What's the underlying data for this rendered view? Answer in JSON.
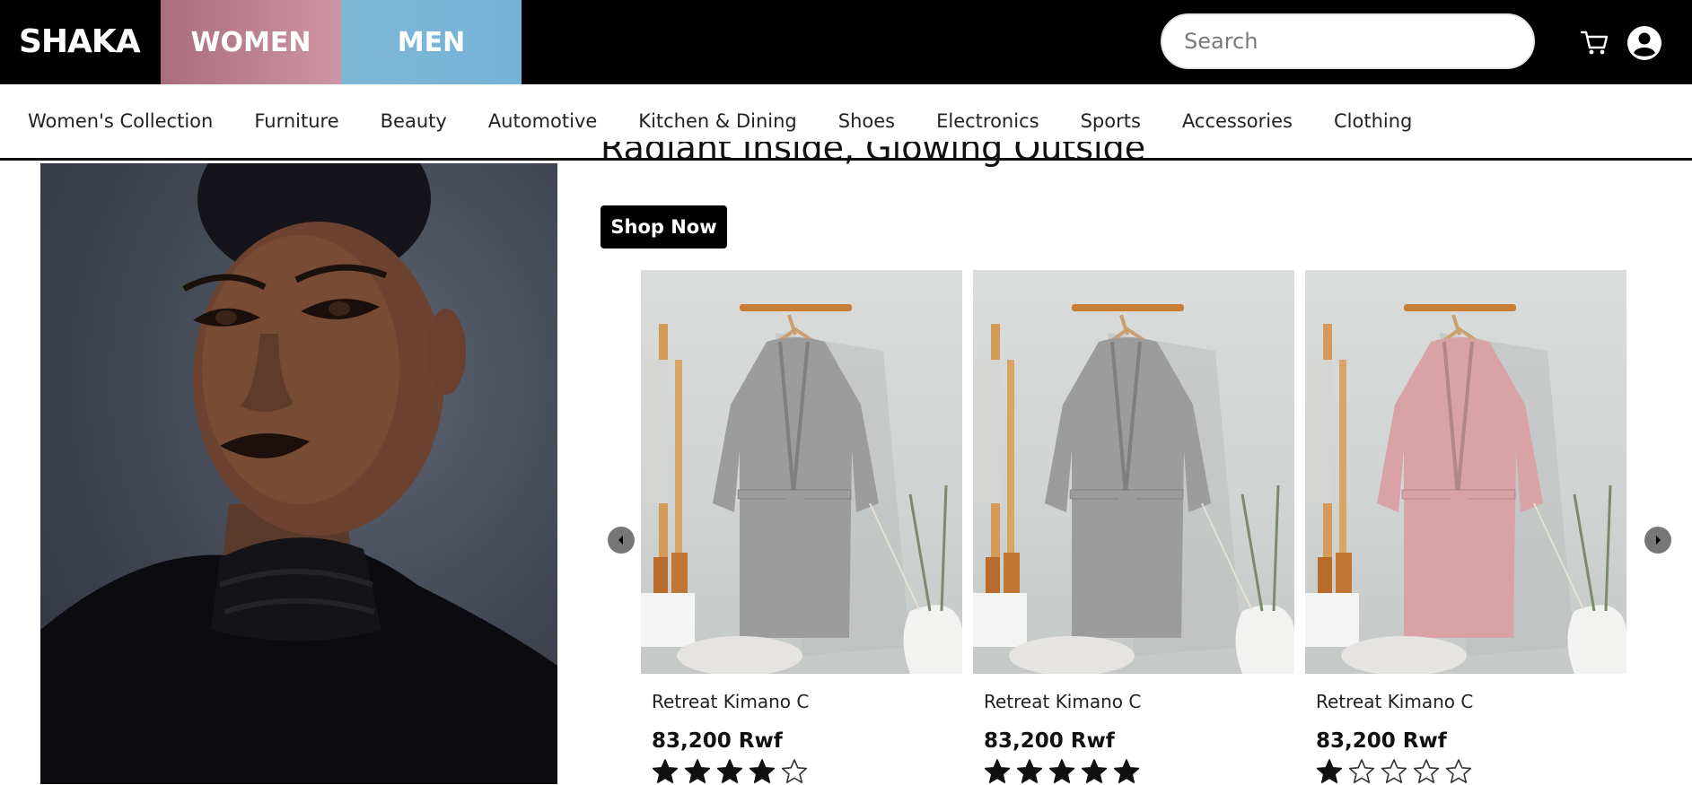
{
  "brand": {
    "logo": "SHAKA"
  },
  "gender_tabs": [
    {
      "label": "WOMEN"
    },
    {
      "label": "MEN"
    }
  ],
  "search": {
    "placeholder": "Search",
    "value": ""
  },
  "icons": {
    "cart": "cart-icon",
    "account": "account-icon"
  },
  "categories": [
    {
      "label": "Women's Collection"
    },
    {
      "label": "Furniture"
    },
    {
      "label": "Beauty"
    },
    {
      "label": "Automotive"
    },
    {
      "label": "Kitchen & Dining"
    },
    {
      "label": "Shoes"
    },
    {
      "label": "Electronics"
    },
    {
      "label": "Sports"
    },
    {
      "label": "Accessories"
    },
    {
      "label": "Clothing"
    }
  ],
  "hero": {
    "headline": "Radiant Inside, Glowing Outside",
    "cta_label": "Shop Now"
  },
  "carousel": {
    "products": [
      {
        "name": "Retreat Kimano C",
        "price": "83,200 Rwf",
        "rating": 4,
        "max_rating": 5,
        "robe_color": "#9c9c9c"
      },
      {
        "name": "Retreat Kimano C",
        "price": "83,200 Rwf",
        "rating": 5,
        "max_rating": 5,
        "robe_color": "#9c9c9c"
      },
      {
        "name": "Retreat Kimano C",
        "price": "83,200 Rwf",
        "rating": 1,
        "max_rating": 5,
        "robe_color": "#d9a3a6"
      }
    ]
  },
  "colors": {
    "women_tab": "#c58c9a",
    "men_tab": "#7ab5d7",
    "header_bg": "#000000"
  }
}
